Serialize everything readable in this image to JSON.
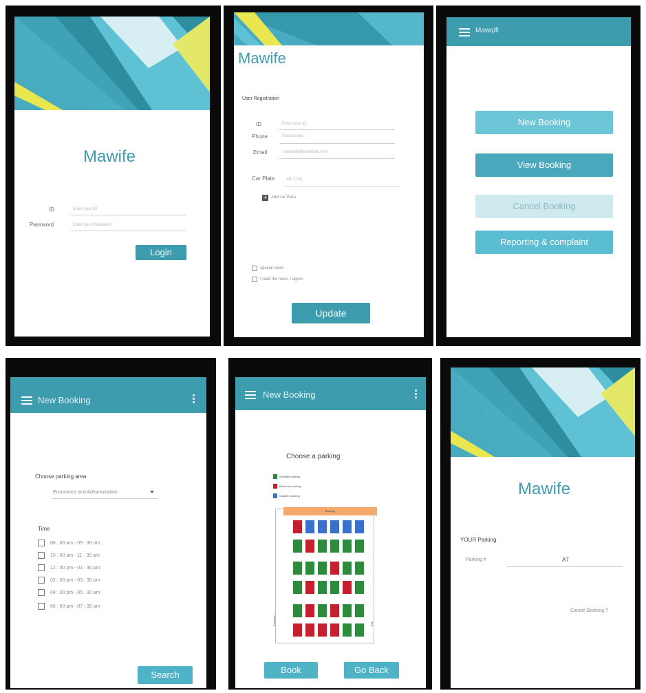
{
  "colors": {
    "primary": "#3d9cae",
    "button_light": "#6cc6d8",
    "button_mid": "#4aa8bd",
    "button_disabled": "#cfeaef",
    "button_report": "#5bbdd1",
    "available": "#2e8b3e",
    "reserved": "#c4202d",
    "disabled": "#3a6fcb",
    "entrance": "#f2a96b"
  },
  "login": {
    "brand": "Mawife",
    "id_label": "ID",
    "id_placeholder": "Enter your ID",
    "password_label": "Password",
    "password_placeholder": "Enter your Password",
    "login_button": "Login"
  },
  "registration": {
    "brand": "Mawife",
    "section_title": "User Registration",
    "id_label": "ID",
    "id_value": "Enter your ID",
    "phone_label": "Phone",
    "phone_value": "05xxxxxxxx",
    "email_label": "Email",
    "email_value": "example@example.com",
    "car_plate_label": "Car Plate",
    "car_plate_value": "AB 1234",
    "add_car_plate": "Add car Plate",
    "special_need": "special need",
    "agree_terms": "I read the rules, I agree",
    "update_button": "Update"
  },
  "menu": {
    "app_title": "Mawqifi",
    "new_booking": "New Booking",
    "view_booking": "View Booking",
    "cancel_booking": "Cancel Booking",
    "reporting": "Reporting & complaint"
  },
  "new_booking": {
    "title": "New Booking",
    "choose_area_label": "Choose parking area",
    "area_selected": "Economics and Administration",
    "time_label": "Time",
    "time_slots": [
      "08 : 00 am - 09 : 30 am",
      "10 : 00 am - 11 : 30 am",
      "12 : 00 pm - 01 : 30 pm",
      "02 : 00 pm - 03 : 30 pm",
      "04 : 00 pm - 05 : 30 am",
      "06 : 00 pm - 07 : 30 am"
    ],
    "search_button": "Search"
  },
  "choose_parking": {
    "title": "New Booking",
    "heading": "Choose a parking",
    "legend": [
      "Available parking",
      "Reserved parking",
      "Disabled parking"
    ],
    "entrance_label": "Building",
    "left_label": "Entrance",
    "right_label": "Exit",
    "rows": [
      [
        "reserved",
        "disabled",
        "disabled",
        "disabled",
        "disabled",
        "disabled"
      ],
      [
        "available",
        "reserved",
        "available",
        "available",
        "available",
        "available"
      ],
      [
        "available",
        "available",
        "available",
        "reserved",
        "available",
        "available"
      ],
      [
        "available",
        "reserved",
        "available",
        "available",
        "reserved",
        "available"
      ],
      [
        "available",
        "reserved",
        "available",
        "reserved",
        "available",
        "available"
      ],
      [
        "reserved",
        "reserved",
        "reserved",
        "reserved",
        "available",
        "available"
      ]
    ],
    "book_button": "Book",
    "back_button": "Go Back"
  },
  "your_parking": {
    "brand": "Mawife",
    "heading": "YOUR Parking",
    "parking_label": "Parking #",
    "parking_value": "A7",
    "cancel_link": "Cancel Booking ?"
  }
}
